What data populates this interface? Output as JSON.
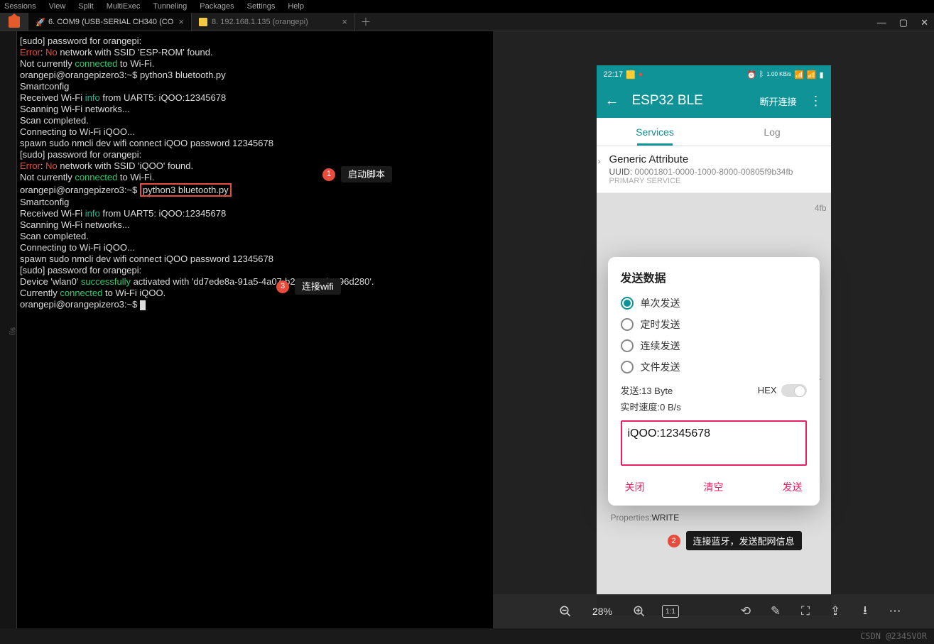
{
  "menu": {
    "sessions": "Sessions",
    "view": "View",
    "split": "Split",
    "multiexec": "MultiExec",
    "tunneling": "Tunneling",
    "packages": "Packages",
    "settings": "Settings",
    "help": "Help"
  },
  "tabs": {
    "tab1": "6. COM9  (USB-SERIAL CH340 (CO",
    "tab2": "8. 192.168.1.135 (orangepi)"
  },
  "leftgutter": "9))",
  "term": {
    "l1a": "[sudo] password for orangepi:",
    "l2a": "Error",
    "l2b": ": ",
    "l2c": "No",
    "l2d": " network with SSID 'ESP-ROM' found.",
    "l3a": "Not currently ",
    "l3b": "connected",
    "l3c": " to Wi-Fi.",
    "l4a": "orangepi@orangepizero3:~$ python3 bluetooth.py",
    "l5": "Smartconfig",
    "l6a": "Received Wi-Fi ",
    "l6b": "info",
    "l6c": " from UART5: iQOO:12345678",
    "l7": "Scanning Wi-Fi networks...",
    "l8": "Scan completed.",
    "l9": "Connecting to Wi-Fi iQOO...",
    "l10": "spawn sudo nmcli dev wifi connect iQOO password 12345678",
    "l11": "[sudo] password for orangepi:",
    "l12a": "Error",
    "l12b": ": ",
    "l12c": "No",
    "l12d": " network with SSID 'iQOO' found.",
    "l13a": "Not currently ",
    "l13b": "connected",
    "l13c": " to Wi-Fi.",
    "l14a": "orangepi@orangepizero3:~$ ",
    "l14cmd": "python3 bluetooth.py",
    "l15": "Smartconfig",
    "l16a": "Received Wi-Fi ",
    "l16b": "info",
    "l16c": " from UART5: iQOO:12345678",
    "l17": "Scanning Wi-Fi networks...",
    "l18": "Scan completed.",
    "l19": "Connecting to Wi-Fi iQOO...",
    "l20": "spawn sudo nmcli dev wifi connect iQOO password 12345678",
    "l21": "[sudo] password for orangepi:",
    "l22a": "Device 'wlan0' ",
    "l22b": "successfully",
    "l22c": " activated with 'dd7ede8a-91a5-4a07-b2c5-45ed2e96d280'.",
    "l23a": "Currently ",
    "l23b": "connected",
    "l23c": " to Wi-Fi iQOO.",
    "l24": "orangepi@orangepizero3:~$ "
  },
  "annot": {
    "a1": "启动脚本",
    "a2": "连接蓝牙，发送配网信息",
    "a3": "连接wifi",
    "n1": "1",
    "n2": "2",
    "n3": "3"
  },
  "phone": {
    "time": "22:17",
    "title": "ESP32 BLE",
    "disconnect": "断开连接",
    "tabServices": "Services",
    "tabLog": "Log",
    "svc1name": "Generic Attribute",
    "svc1uuidlbl": "UUID: ",
    "svc1uuid": "00001801-0000-1000-8000-00805f9b34fb",
    "svc1pri": "PRIMARY SERVICE",
    "svc2frag": "4fb",
    "propsLbl": "Properties:",
    "propsVal": "WRITE",
    "statusKbs": "1.00\nKB/s"
  },
  "dialog": {
    "title": "发送数据",
    "r1": "单次发送",
    "r2": "定时发送",
    "r3": "连续发送",
    "r4": "文件发送",
    "sendLbl": "发送:13 Byte",
    "hex": "HEX",
    "speed": "实时速度:0 B/s",
    "input": "iQOO:12345678",
    "close": "关闭",
    "clear": "清空",
    "send": "发送"
  },
  "bottom": {
    "zoom": "28%"
  },
  "watermark": "CSDN @2345VOR"
}
